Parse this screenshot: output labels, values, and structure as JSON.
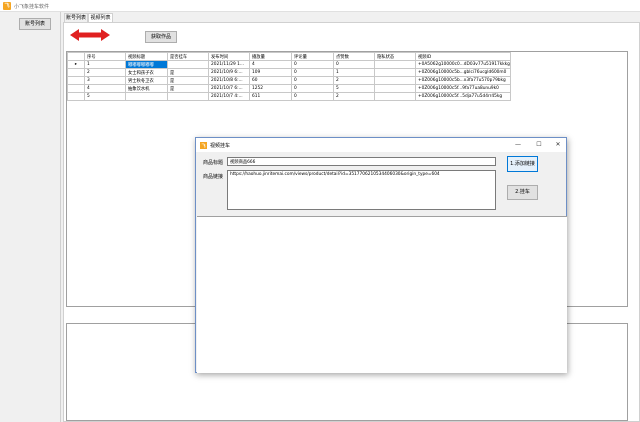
{
  "app": {
    "title": "小飞象挂车软件",
    "icon_text": "飞"
  },
  "sidebar": {
    "account_button": "账号列表"
  },
  "tabs": [
    {
      "label": "账号列表"
    },
    {
      "label": "视频列表"
    }
  ],
  "toolbar": {
    "fetch_label": "获取作品"
  },
  "table": {
    "columns": [
      "序号",
      "视频标题",
      "是否挂车",
      "发布时间",
      "播放量",
      "评论量",
      "点赞数",
      "隐私状态",
      "视频ID"
    ],
    "rows": [
      [
        "1",
        "嘟嘟嘟嘟嘟嘟",
        "",
        "2021/11/29 1...",
        "4",
        "0",
        "0",
        "",
        "+0A5062g10000c0...dD03v77u51917kkkg"
      ],
      [
        "2",
        "女士和孩子衣",
        "是",
        "2021/10/9 6:...",
        "109",
        "0",
        "1",
        "",
        "+0Z006g10000c5b...gblci76ucgld600m0"
      ],
      [
        "3",
        "男士秋冬卫衣",
        "是",
        "2021/10/8 6:...",
        "60",
        "0",
        "2",
        "",
        "+0Z006g10000c5b...x3fa77u570p79bkg"
      ],
      [
        "4",
        "抽象饮水机",
        "是",
        "2021/10/7 6:...",
        "1252",
        "0",
        "5",
        "",
        "+0Z006g10000c5f...9fa77ua8unu9k0"
      ],
      [
        "5",
        "",
        "",
        "2021/10/7 4:...",
        "611",
        "0",
        "2",
        "",
        "+0Z006g10000c5f...5dja77u5d4rr45kg"
      ]
    ],
    "current_row_marker": "▸"
  },
  "dialog": {
    "title": "视频挂车",
    "icon_text": "飞",
    "title_label": "商品标题",
    "title_value": "视频商品666",
    "link_label": "商品链接",
    "link_value": "https://haohuo.jinritemai.com/views/product/detail?id=3517706210534406030&origin_type=604",
    "add_button": "1.添加链接",
    "attach_button": "2.挂车",
    "minimize": "—",
    "maximize": "☐",
    "close": "✕"
  },
  "colors": {
    "accent": "#0078d7",
    "arrow": "#e02020",
    "icon": "#f5a623"
  }
}
